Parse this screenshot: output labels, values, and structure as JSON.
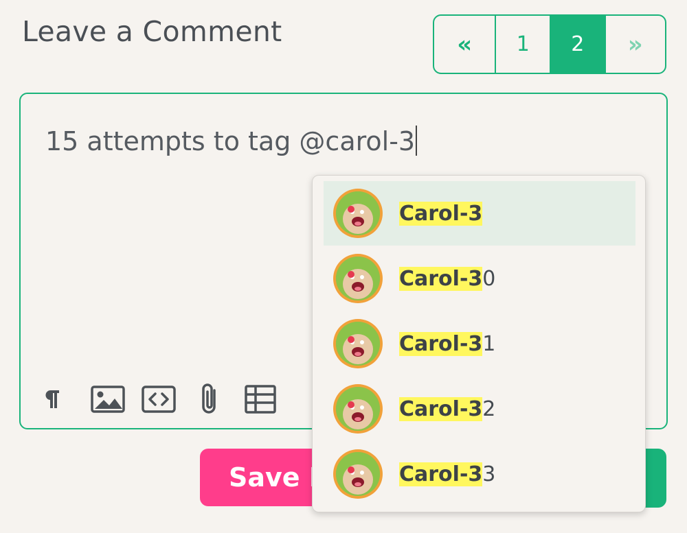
{
  "header": {
    "title": "Leave a Comment"
  },
  "pagination": {
    "prev_label": "«",
    "next_label": "»",
    "pages": [
      "1",
      "2"
    ],
    "active_page": "2"
  },
  "editor": {
    "text": "15 attempts to tag @carol-3",
    "toolbar": [
      "paragraph-icon",
      "image-icon",
      "code-icon",
      "attachment-icon",
      "table-icon"
    ]
  },
  "buttons": {
    "save_visible": "Save D"
  },
  "mentions": [
    {
      "match": "Carol-3",
      "rest": "",
      "selected": true
    },
    {
      "match": "Carol-3",
      "rest": "0",
      "selected": false
    },
    {
      "match": "Carol-3",
      "rest": "1",
      "selected": false
    },
    {
      "match": "Carol-3",
      "rest": "2",
      "selected": false
    },
    {
      "match": "Carol-3",
      "rest": "3",
      "selected": false
    }
  ],
  "colors": {
    "accent": "#19b37a",
    "save": "#ff3d8b",
    "highlight": "#fff75e"
  }
}
